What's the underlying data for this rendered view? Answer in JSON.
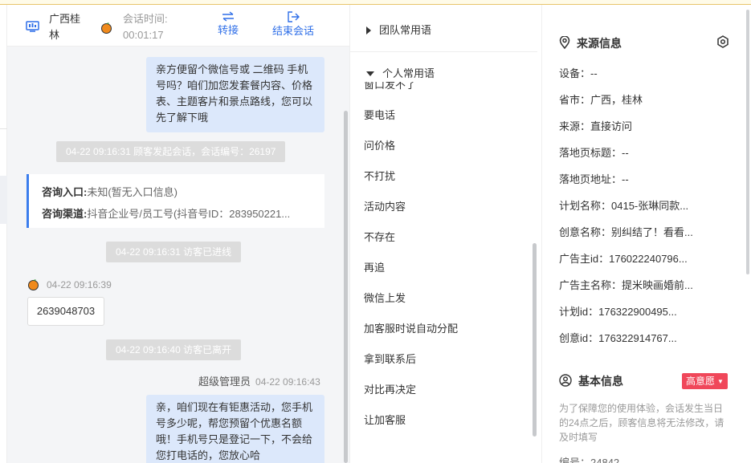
{
  "header": {
    "location": "广西桂林",
    "session_time_label": "会话时间:",
    "session_time_value": "00:01:17",
    "transfer_label": "转接",
    "end_label": "结束会话"
  },
  "chat": {
    "msg1": "亲方便留个微信号或 二维码 手机号吗？咱们加您发套餐内容、价格表、主题客片和景点路线，您可以先了解下哦",
    "sys1": "04-22 09:16:31 顾客发起会话，会话编号：26197",
    "info_entry_label": "咨询入口:",
    "info_entry_value": "未知(暂无入口信息)",
    "info_channel_label": "咨询渠道:",
    "info_channel_value": "抖音企业号/员工号(抖音号ID：283950221...",
    "sys2": "04-22 09:16:31 访客已进线",
    "visitor_time": "04-22 09:16:39",
    "visitor_msg": "2639048703",
    "sys3": "04-22 09:16:40 访客已离开",
    "sender_name": "超级管理员",
    "sender_time": "04-22 09:16:43",
    "msg2": "亲，咱们现在有钜惠活动，您手机号多少呢，帮您预留个优惠名额哦！手机号只是登记一下，不会给您打电话的，您放心哈"
  },
  "phrases": {
    "team_group": "团队常用语",
    "personal_group": "个人常用语",
    "partial_item": "窗口发不了",
    "items": [
      "要电话",
      "问价格",
      "不打扰",
      "活动内容",
      "不存在",
      "再追",
      "微信上发",
      "加客服时说自动分配",
      "拿到联系后",
      "对比再决定",
      "让加客服"
    ]
  },
  "source": {
    "title": "来源信息",
    "device": "设备：--",
    "province": "省市：广西，桂林",
    "origin": "来源：直接访问",
    "landing_title": "落地页标题：--",
    "landing_url": "落地页地址：--",
    "plan_name": "计划名称：0415-张琳同款...",
    "creative_name": "创意名称：别纠结了！看看...",
    "advertiser_id": "广告主id：176022240796...",
    "advertiser_name": "广告主名称：提米映画婚前...",
    "plan_id": "计划id：176322900495...",
    "creative_id": "创意id：176322914767..."
  },
  "basic": {
    "title": "基本信息",
    "intent_tag": "高意愿",
    "note": "为了保障您的使用体验，会话发生当日的24点之后，顾客信息将无法修改，请及时填写",
    "number_partial": "编号：24842"
  },
  "colors": {
    "accent": "#2f6fe8",
    "bubble": "#dce8fb",
    "tag_red": "#f0475a",
    "info_border": "#3b7ded"
  }
}
